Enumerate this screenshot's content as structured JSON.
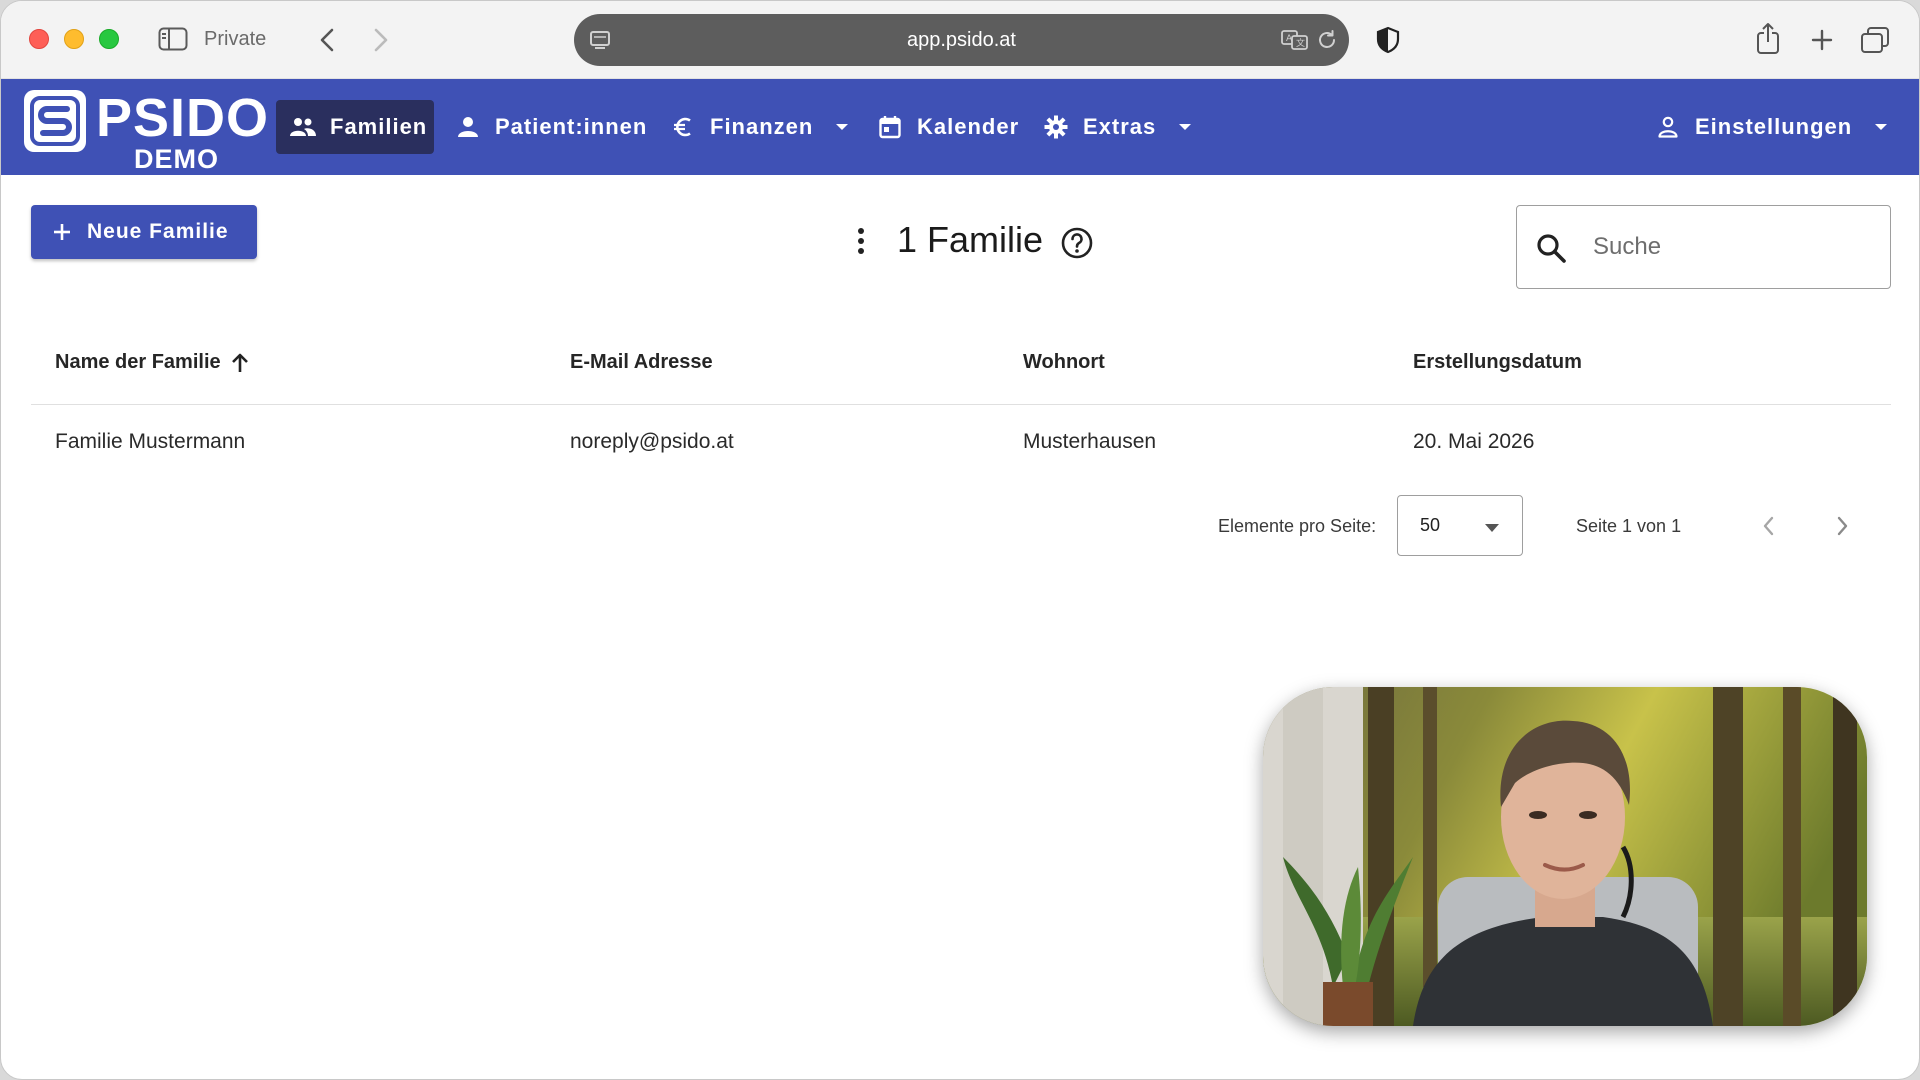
{
  "browser": {
    "private_label": "Private",
    "url": "app.psido.at"
  },
  "app": {
    "logo_text": "PSIDO",
    "logo_sub": "DEMO",
    "brand_color": "#3f51b5",
    "nav": {
      "familien": "Familien",
      "patienten": "Patient:innen",
      "finanzen": "Finanzen",
      "kalender": "Kalender",
      "extras": "Extras",
      "settings": "Einstellungen"
    }
  },
  "toolbar": {
    "new_button_label": "Neue Familie",
    "title": "1 Familie",
    "search_placeholder": "Suche"
  },
  "table": {
    "columns": [
      "Name der Familie",
      "E-Mail Adresse",
      "Wohnort",
      "Erstellungsdatum"
    ],
    "rows": [
      [
        "Familie Mustermann",
        "noreply@psido.at",
        "Musterhausen",
        "20. Mai 2026"
      ]
    ]
  },
  "pagination": {
    "per_page_label": "Elemente pro Seite:",
    "per_page_value": "50",
    "range_text": "Seite 1 von 1"
  },
  "icons": [
    "sidebar-icon",
    "back-icon",
    "forward-icon",
    "site-icon",
    "translate-icon",
    "reload-icon",
    "shield-icon",
    "share-icon",
    "plus-icon",
    "tabs-icon",
    "people-icon",
    "person-icon",
    "euro-icon",
    "calendar-icon",
    "gear-icon",
    "chevron-down-icon",
    "more-vert-icon",
    "help-icon",
    "search-icon",
    "arrow-up-icon",
    "chevron-left-icon",
    "chevron-right-icon"
  ]
}
